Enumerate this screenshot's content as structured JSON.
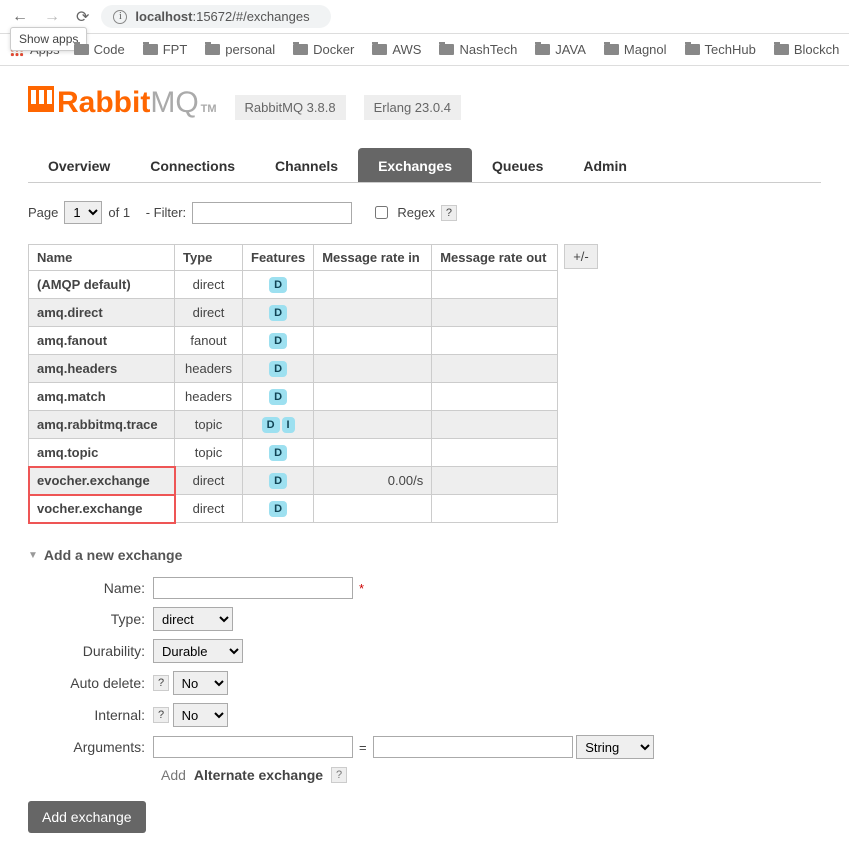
{
  "browser": {
    "tooltip": "Show apps",
    "url_prefix": "localhost",
    "url_suffix": ":15672/#/exchanges",
    "apps_label": "Apps",
    "bookmarks": [
      "Code",
      "FPT",
      "personal",
      "Docker",
      "AWS",
      "NashTech",
      "JAVA",
      "Magnol",
      "TechHub",
      "Blockch"
    ]
  },
  "header": {
    "logo_a": "Rabbit",
    "logo_b": "MQ",
    "tm": "TM",
    "ver1": "RabbitMQ 3.8.8",
    "ver2": "Erlang 23.0.4"
  },
  "tabs": [
    "Overview",
    "Connections",
    "Channels",
    "Exchanges",
    "Queues",
    "Admin"
  ],
  "filter": {
    "page_label": "Page",
    "page_value": "1",
    "of_label": "of 1",
    "dash_filter": "- Filter:",
    "regex_label": "Regex",
    "help": "?"
  },
  "table": {
    "headers": [
      "Name",
      "Type",
      "Features",
      "Message rate in",
      "Message rate out"
    ],
    "plusminus": "+/-",
    "rows": [
      {
        "name": "(AMQP default)",
        "type": "direct",
        "features": [
          "D"
        ],
        "rate_in": "",
        "rate_out": "",
        "hl": false
      },
      {
        "name": "amq.direct",
        "type": "direct",
        "features": [
          "D"
        ],
        "rate_in": "",
        "rate_out": "",
        "hl": false
      },
      {
        "name": "amq.fanout",
        "type": "fanout",
        "features": [
          "D"
        ],
        "rate_in": "",
        "rate_out": "",
        "hl": false
      },
      {
        "name": "amq.headers",
        "type": "headers",
        "features": [
          "D"
        ],
        "rate_in": "",
        "rate_out": "",
        "hl": false
      },
      {
        "name": "amq.match",
        "type": "headers",
        "features": [
          "D"
        ],
        "rate_in": "",
        "rate_out": "",
        "hl": false
      },
      {
        "name": "amq.rabbitmq.trace",
        "type": "topic",
        "features": [
          "D",
          "I"
        ],
        "rate_in": "",
        "rate_out": "",
        "hl": false
      },
      {
        "name": "amq.topic",
        "type": "topic",
        "features": [
          "D"
        ],
        "rate_in": "",
        "rate_out": "",
        "hl": false
      },
      {
        "name": "evocher.exchange",
        "type": "direct",
        "features": [
          "D"
        ],
        "rate_in": "0.00/s",
        "rate_out": "",
        "hl": true
      },
      {
        "name": "vocher.exchange",
        "type": "direct",
        "features": [
          "D"
        ],
        "rate_in": "",
        "rate_out": "",
        "hl": true
      }
    ]
  },
  "section": {
    "title": "Add a new exchange"
  },
  "form": {
    "name_label": "Name:",
    "type_label": "Type:",
    "type_value": "direct",
    "durability_label": "Durability:",
    "durability_value": "Durable",
    "autodelete_label": "Auto delete:",
    "autodelete_value": "No",
    "internal_label": "Internal:",
    "internal_value": "No",
    "arguments_label": "Arguments:",
    "eq": "=",
    "argtype_value": "String",
    "add_label": "Add",
    "alt_label": "Alternate exchange",
    "submit": "Add exchange",
    "help": "?"
  }
}
